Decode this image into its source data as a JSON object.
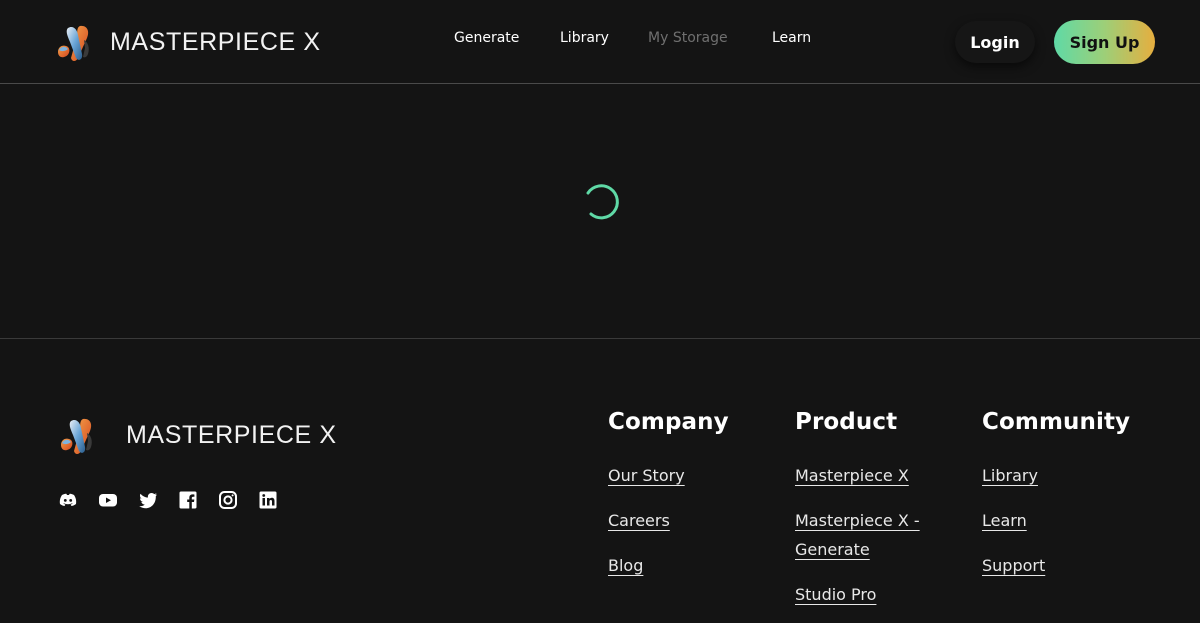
{
  "brand": {
    "name": "MASTERPIECE X",
    "logo_icon": "masterpiece-x-logo"
  },
  "nav": {
    "items": [
      {
        "label": "Generate",
        "state": "active"
      },
      {
        "label": "Library",
        "state": "active"
      },
      {
        "label": "My Storage",
        "state": "disabled"
      },
      {
        "label": "Learn",
        "state": "active"
      }
    ]
  },
  "auth": {
    "login_label": "Login",
    "signup_label": "Sign Up"
  },
  "main": {
    "loading_spinner": "loading-spinner-icon",
    "spinner_color": "#5fd9a6"
  },
  "footer": {
    "socials": [
      "discord-icon",
      "youtube-icon",
      "twitter-icon",
      "facebook-icon",
      "instagram-icon",
      "linkedin-icon"
    ],
    "columns": [
      {
        "title": "Company",
        "links": [
          "Our Story",
          "Careers",
          "Blog"
        ]
      },
      {
        "title": "Product",
        "links": [
          "Masterpiece X",
          "Masterpiece X - Generate",
          "Studio Pro"
        ]
      },
      {
        "title": "Community",
        "links": [
          "Library",
          "Learn",
          "Support"
        ]
      }
    ]
  },
  "colors": {
    "background": "#141414",
    "accent_gradient_start": "#5fd9a6",
    "accent_gradient_end": "#e6ae3f"
  }
}
